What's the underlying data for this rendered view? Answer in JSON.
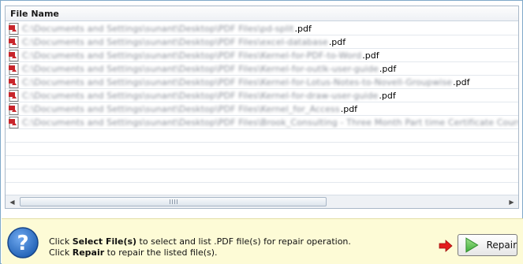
{
  "file_list": {
    "column_header": "File Name",
    "rows": [
      {
        "path": "C:\\Documents and Settings\\sunant\\Desktop\\PDF Files\\pd-split",
        "ext": ".pdf"
      },
      {
        "path": "C:\\Documents and Settings\\sunant\\Desktop\\PDF Files\\excel-database",
        "ext": ".pdf"
      },
      {
        "path": "C:\\Documents and Settings\\sunant\\Desktop\\PDF Files\\Kernel-for-PDF-to-Word",
        "ext": ".pdf"
      },
      {
        "path": "C:\\Documents and Settings\\sunant\\Desktop\\PDF Files\\Kernel-for-outlk-user-guide",
        "ext": ".pdf"
      },
      {
        "path": "C:\\Documents and Settings\\sunant\\Desktop\\PDF Files\\Kernel-for-Lotus-Notes-to-Novell-Groupwise",
        "ext": ".pdf"
      },
      {
        "path": "C:\\Documents and Settings\\sunant\\Desktop\\PDF Files\\Kernel-for-draw-user-guide",
        "ext": ".pdf"
      },
      {
        "path": "C:\\Documents and Settings\\sunant\\Desktop\\PDF Files\\Kernel_for_Access",
        "ext": ".pdf"
      },
      {
        "path": "C:\\Documents and Settings\\sunant\\Desktop\\PDF Files\\Brook_Consulting - Three Month Part time Certificate Course in Technical Writing",
        "ext": ""
      }
    ]
  },
  "instructions": {
    "line1_prefix": "Click ",
    "line1_bold": "Select File(s)",
    "line1_suffix": " to select and list .PDF file(s) for repair operation.",
    "line2_prefix": "Click ",
    "line2_bold": "Repair",
    "line2_suffix": " to repair the listed file(s)."
  },
  "repair_button": {
    "label": "Repair"
  },
  "icons": {
    "file_icon": "pdf-file-icon",
    "help_icon": "question-mark-icon",
    "arrow_icon": "red-arrow-right-icon",
    "repair_icon": "green-play-icon"
  },
  "colors": {
    "bottom_bar_bg": "#fdfbd6",
    "help_blue": "#1e5fb3",
    "arrow_red": "#e31b1b",
    "play_green": "#3fae3a",
    "pdf_red": "#c8252b"
  }
}
